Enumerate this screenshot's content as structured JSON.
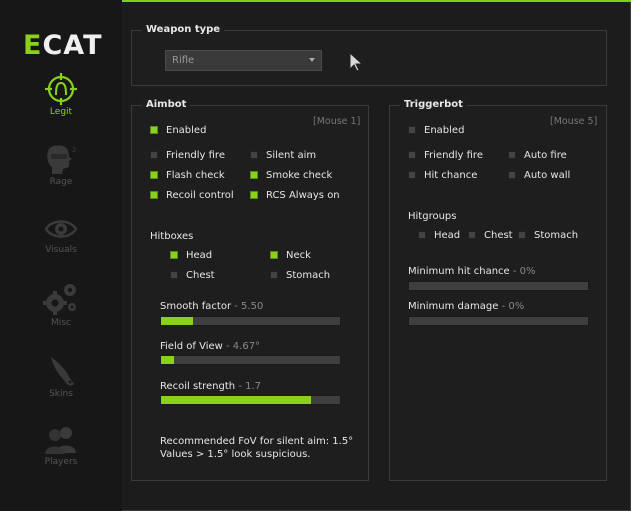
{
  "logo": {
    "first": "E",
    "rest": "CAT"
  },
  "nav": [
    {
      "label": "Legit",
      "icon": "crosshair-head-icon",
      "active": true
    },
    {
      "label": "Rage",
      "icon": "masked-head-icon"
    },
    {
      "label": "Visuals",
      "icon": "eye-icon"
    },
    {
      "label": "Misc",
      "icon": "gears-icon"
    },
    {
      "label": "Skins",
      "icon": "knife-icon"
    },
    {
      "label": "Players",
      "icon": "users-icon"
    }
  ],
  "weapon_type": {
    "title": "Weapon type",
    "selected": "Rifle"
  },
  "aimbot": {
    "title": "Aimbot",
    "bind": "[Mouse 1]",
    "enabled": {
      "label": "Enabled",
      "checked": true
    },
    "options": [
      {
        "label": "Friendly fire",
        "checked": false
      },
      {
        "label": "Silent aim",
        "checked": false
      },
      {
        "label": "Flash check",
        "checked": true
      },
      {
        "label": "Smoke check",
        "checked": true
      },
      {
        "label": "Recoil control",
        "checked": true
      },
      {
        "label": "RCS Always on",
        "checked": true
      }
    ],
    "hitboxes_title": "Hitboxes",
    "hitboxes": [
      {
        "label": "Head",
        "checked": true
      },
      {
        "label": "Neck",
        "checked": true
      },
      {
        "label": "Chest",
        "checked": false
      },
      {
        "label": "Stomach",
        "checked": false
      }
    ],
    "sliders": [
      {
        "label": "Smooth factor",
        "value_text": "- 5.50",
        "fraction": 0.18
      },
      {
        "label": "Field of View",
        "value_text": "- 4.67°",
        "fraction": 0.07
      },
      {
        "label": "Recoil strength",
        "value_text": "- 1.7",
        "fraction": 0.84
      }
    ],
    "note_line1": "Recommended FoV for silent aim: 1.5°",
    "note_line2": "Values > 1.5° look suspicious."
  },
  "triggerbot": {
    "title": "Triggerbot",
    "bind": "[Mouse 5]",
    "enabled": {
      "label": "Enabled",
      "checked": false
    },
    "options": [
      {
        "label": "Friendly fire",
        "checked": false
      },
      {
        "label": "Auto fire",
        "checked": false
      },
      {
        "label": "Hit chance",
        "checked": false
      },
      {
        "label": "Auto wall",
        "checked": false
      }
    ],
    "hitgroups_title": "Hitgroups",
    "hitgroups": [
      {
        "label": "Head",
        "checked": false
      },
      {
        "label": "Chest",
        "checked": false
      },
      {
        "label": "Stomach",
        "checked": false
      }
    ],
    "sliders": [
      {
        "label": "Minimum hit chance",
        "value_text": "- 0%",
        "fraction": 0
      },
      {
        "label": "Minimum damage",
        "value_text": "- 0%",
        "fraction": 0
      }
    ]
  },
  "colors": {
    "accent": "#8ad21a",
    "background": "#1c1c1c",
    "panel_border": "#3b3b3b"
  }
}
